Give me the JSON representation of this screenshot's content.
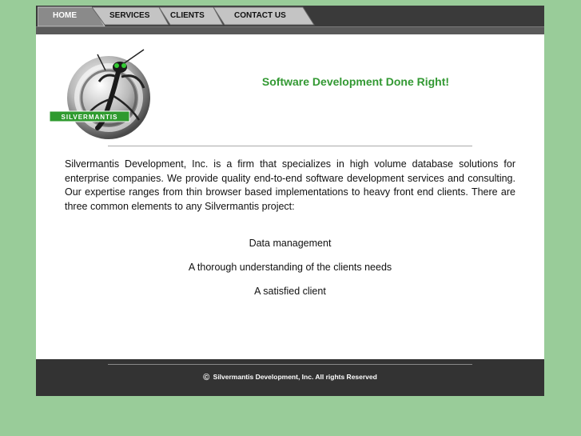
{
  "nav": {
    "tabs": [
      {
        "label": "HOME",
        "active": true
      },
      {
        "label": "SERVICES",
        "active": false
      },
      {
        "label": "CLIENTS",
        "active": false
      },
      {
        "label": "CONTACT US",
        "active": false
      }
    ]
  },
  "logo": {
    "text": "SILVERMANTIS"
  },
  "header": {
    "tagline": "Software Development Done Right!"
  },
  "main": {
    "intro": "Silvermantis Development, Inc. is a firm that specializes in high volume database solutions for enterprise companies. We provide quality end-to-end software development services and consulting. Our expertise ranges from thin browser based implementations to heavy front end clients. There are three common elements to any Silvermantis project:",
    "elements": [
      "Data management",
      "A thorough understanding of the clients needs",
      "A satisfied client"
    ]
  },
  "footer": {
    "copyright_symbol": "©",
    "copyright_text": "Silvermantis Development, Inc. All rights Reserved"
  },
  "colors": {
    "page_background": "#99cc99",
    "tagline": "#339933",
    "nav_background": "#3a3a3a",
    "footer_background": "#333333",
    "logo_band": "#2e9a2e"
  }
}
